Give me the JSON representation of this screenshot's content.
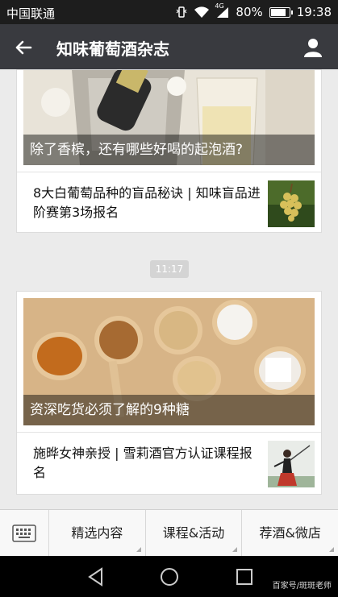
{
  "status_bar": {
    "carrier": "中国联通",
    "network": "4G",
    "battery_percent": "80%",
    "battery_level": 0.8,
    "time": "19:38"
  },
  "title_bar": {
    "title": "知味葡萄酒杂志",
    "icons": {
      "back": "back-arrow-icon",
      "profile": "user-profile-icon"
    }
  },
  "articles": [
    {
      "headline": "除了香槟，还有哪些好喝的起泡酒?",
      "sub_items": [
        {
          "title": "8大白葡萄品种的盲品秘诀 | 知味盲品进阶赛第3场报名"
        }
      ]
    },
    {
      "timestamp": "11:17",
      "headline": "资深吃货必须了解的9种糖",
      "sub_items": [
        {
          "title": "施晔女神亲授 | 雪莉酒官方认证课程报名"
        }
      ]
    }
  ],
  "menu_bar": {
    "keyboard_icon": "keyboard-icon",
    "items": [
      {
        "label": "精选内容"
      },
      {
        "label": "课程&活动"
      },
      {
        "label": "荐酒&微店"
      }
    ]
  },
  "nav_bar": {
    "watermark": "百家号/斑斑老师"
  },
  "colors": {
    "title_bar": "#393a3f",
    "status_bar": "#1d1d1d",
    "page_bg": "#ebebeb"
  }
}
